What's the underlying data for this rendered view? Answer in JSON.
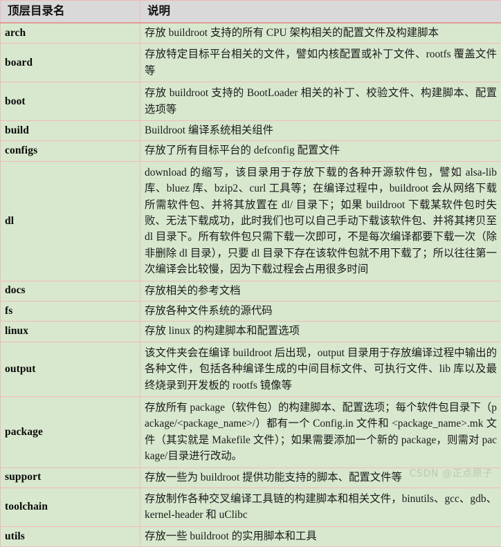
{
  "table": {
    "headers": {
      "name": "顶层目录名",
      "description": "说明"
    },
    "rows": [
      {
        "name": "arch",
        "description": "存放 buildroot 支持的所有 CPU 架构相关的配置文件及构建脚本"
      },
      {
        "name": "board",
        "description": "存放特定目标平台相关的文件，譬如内核配置或补丁文件、rootfs 覆盖文件等"
      },
      {
        "name": "boot",
        "description": "存放 buildroot 支持的 BootLoader 相关的补丁、校验文件、构建脚本、配置选项等"
      },
      {
        "name": "build",
        "description": "Buildroot 编译系统相关组件"
      },
      {
        "name": "configs",
        "description": "存放了所有目标平台的 defconfig 配置文件"
      },
      {
        "name": "dl",
        "description": "download 的缩写，该目录用于存放下载的各种开源软件包，譬如 alsa-lib 库、bluez 库、bzip2、curl 工具等；在编译过程中，buildroot 会从网络下载所需软件包、并将其放置在 dl/ 目录下；如果 buildroot 下载某软件包时失败、无法下载成功，此时我们也可以自己手动下载该软件包、并将其拷贝至 dl 目录下。所有软件包只需下载一次即可，不是每次编译都要下载一次（除非删除 dl 目录），只要 dl 目录下存在该软件包就不用下载了；所以往往第一次编译会比较慢，因为下载过程会占用很多时间"
      },
      {
        "name": "docs",
        "description": "存放相关的参考文档"
      },
      {
        "name": "fs",
        "description": "存放各种文件系统的源代码"
      },
      {
        "name": "linux",
        "description": "存放 linux 的构建脚本和配置选项"
      },
      {
        "name": "output",
        "description": "该文件夹会在编译 buildroot 后出现，output 目录用于存放编译过程中输出的各种文件，包括各种编译生成的中间目标文件、可执行文件、lib 库以及最终烧录到开发板的 rootfs 镜像等"
      },
      {
        "name": "package",
        "description": "存放所有 package（软件包）的构建脚本、配置选项；每个软件包目录下（package/<package_name>/）都有一个 Config.in 文件和 <package_name>.mk 文件（其实就是 Makefile 文件）；如果需要添加一个新的 package，则需对 package/目录进行改动。"
      },
      {
        "name": "support",
        "description": "存放一些为 buildroot 提供功能支持的脚本、配置文件等"
      },
      {
        "name": "toolchain",
        "description": "存放制作各种交叉编译工具链的构建脚本和相关文件，binutils、gcc、gdb、kernel-header 和 uClibc"
      },
      {
        "name": "utils",
        "description": "存放一些 buildroot 的实用脚本和工具"
      }
    ]
  },
  "watermark": {
    "text": "CSDN @正点原子"
  },
  "colors": {
    "header_background": "#d9d9d9",
    "body_background": "#d8e8ce",
    "border": "#f0b9b9",
    "text": "#1a1a1a",
    "watermark": "#b9c9b0"
  }
}
